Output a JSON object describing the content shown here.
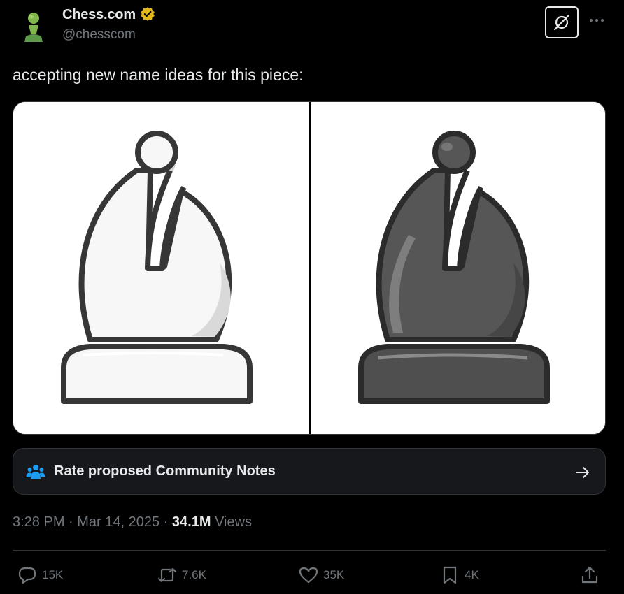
{
  "author": {
    "display_name": "Chess.com",
    "handle": "@chesscom",
    "avatar_icon": "pawn-logo-icon",
    "verified_icon": "verified-badge-icon",
    "verified_color": "#e2b719"
  },
  "header": {
    "grok_icon": "grok-icon",
    "more_icon": "more-dots-icon"
  },
  "tweet": {
    "text": "accepting new name ideas for this piece:"
  },
  "media": {
    "left_piece_icon": "white-bishop-icon",
    "right_piece_icon": "black-bishop-icon"
  },
  "community_notes": {
    "label": "Rate proposed Community Notes",
    "icon": "people-icon",
    "icon_color": "#1d9bf0",
    "arrow_icon": "arrow-right-icon"
  },
  "meta": {
    "time": "3:28 PM",
    "separator": " · ",
    "date": "Mar 14, 2025",
    "views_count": "34.1M",
    "views_label": "Views"
  },
  "actions": {
    "replies": "15K",
    "reposts": "7.6K",
    "likes": "35K",
    "bookmarks": "4K"
  },
  "colors": {
    "background": "#000000",
    "text": "#e7e9ea",
    "muted": "#71767b",
    "border": "#2f3336"
  }
}
